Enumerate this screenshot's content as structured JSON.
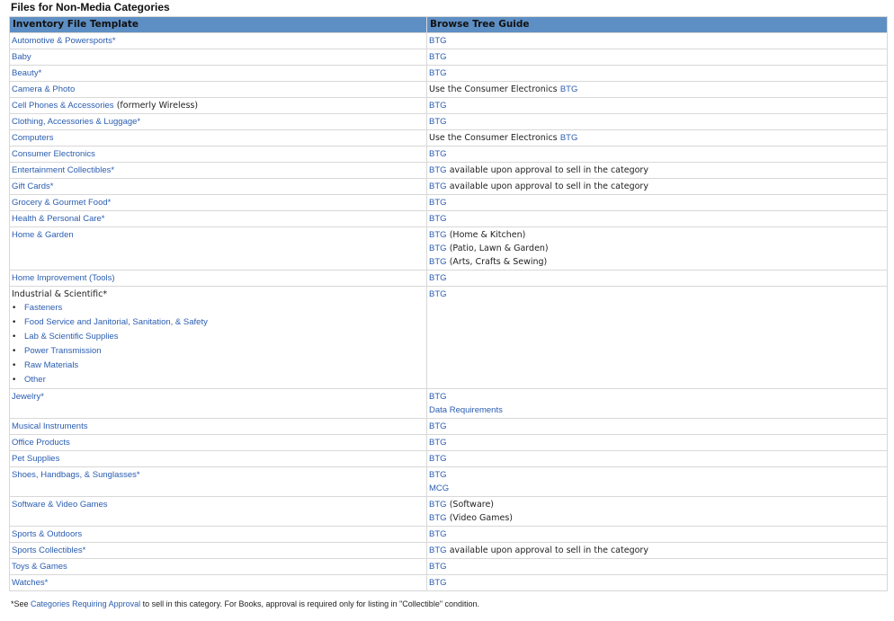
{
  "page_title": "Files for Non-Media Categories",
  "table": {
    "headers": [
      "Inventory File Template",
      "Browse Tree Guide"
    ],
    "rows": [
      {
        "category": "Automotive & Powersports*",
        "guides": [
          {
            "link": "BTG",
            "text": ""
          }
        ]
      },
      {
        "category": "Baby",
        "guides": [
          {
            "link": "BTG",
            "text": ""
          }
        ]
      },
      {
        "category": "Beauty*",
        "guides": [
          {
            "link": "BTG",
            "text": ""
          }
        ]
      },
      {
        "category": "Camera & Photo",
        "guides": [
          {
            "prefix": "Use the Consumer Electronics",
            "link": "BTG",
            "text": ""
          }
        ]
      },
      {
        "category": "Cell Phones & Accessories",
        "category_note": "(formerly Wireless)",
        "guides": [
          {
            "link": "BTG",
            "text": ""
          }
        ]
      },
      {
        "category": "Clothing, Accessories & Luggage*",
        "guides": [
          {
            "link": "BTG",
            "text": ""
          }
        ]
      },
      {
        "category": "Computers",
        "guides": [
          {
            "prefix": "Use the Consumer Electronics",
            "link": "BTG",
            "text": ""
          }
        ]
      },
      {
        "category": "Consumer Electronics",
        "guides": [
          {
            "link": "BTG",
            "text": ""
          }
        ]
      },
      {
        "category": "Entertainment Collectibles*",
        "guides": [
          {
            "link": "BTG",
            "text": "available upon approval to sell in the category"
          }
        ]
      },
      {
        "category": "Gift Cards*",
        "guides": [
          {
            "link": "BTG",
            "text": "available upon approval to sell in the category"
          }
        ]
      },
      {
        "category": "Grocery & Gourmet Food*",
        "guides": [
          {
            "link": "BTG",
            "text": ""
          }
        ]
      },
      {
        "category": "Health & Personal Care*",
        "guides": [
          {
            "link": "BTG",
            "text": ""
          }
        ]
      },
      {
        "category": "Home & Garden",
        "guides": [
          {
            "link": "BTG",
            "text": "(Home & Kitchen)"
          },
          {
            "link": "BTG",
            "text": "(Patio, Lawn & Garden)"
          },
          {
            "link": "BTG",
            "text": "(Arts, Crafts & Sewing)"
          }
        ]
      },
      {
        "category": "Home Improvement (Tools)",
        "guides": [
          {
            "link": "BTG",
            "text": ""
          }
        ]
      },
      {
        "category": "Industrial & Scientific*",
        "plain": true,
        "subitems": [
          "Fasteners",
          "Food Service and Janitorial, Sanitation, & Safety",
          "Lab & Scientific Supplies",
          "Power Transmission",
          "Raw Materials",
          "Other"
        ],
        "guides": [
          {
            "link": "BTG",
            "text": ""
          }
        ]
      },
      {
        "category": "Jewelry*",
        "guides": [
          {
            "link": "BTG",
            "text": ""
          },
          {
            "link": "Data Requirements",
            "text": ""
          }
        ]
      },
      {
        "category": "Musical Instruments",
        "guides": [
          {
            "link": "BTG",
            "text": ""
          }
        ]
      },
      {
        "category": "Office Products",
        "guides": [
          {
            "link": "BTG",
            "text": ""
          }
        ]
      },
      {
        "category": "Pet Supplies",
        "guides": [
          {
            "link": "BTG",
            "text": ""
          }
        ]
      },
      {
        "category": "Shoes, Handbags, & Sunglasses*",
        "guides": [
          {
            "link": "BTG",
            "text": ""
          },
          {
            "link": "MCG",
            "text": ""
          }
        ]
      },
      {
        "category": "Software & Video Games",
        "guides": [
          {
            "link": "BTG",
            "text": "(Software)"
          },
          {
            "link": "BTG",
            "text": "(Video Games)"
          }
        ]
      },
      {
        "category": "Sports & Outdoors",
        "guides": [
          {
            "link": "BTG",
            "text": ""
          }
        ]
      },
      {
        "category": "Sports Collectibles*",
        "guides": [
          {
            "link": "BTG",
            "text": "available upon approval to sell in the category"
          }
        ]
      },
      {
        "category": "Toys & Games",
        "guides": [
          {
            "link": "BTG",
            "text": ""
          }
        ]
      },
      {
        "category": "Watches*",
        "guides": [
          {
            "link": "BTG",
            "text": ""
          }
        ]
      }
    ]
  },
  "footnote": {
    "prefix": "*See",
    "link": "Categories Requiring Approval",
    "suffix": "to sell in this category. For Books, approval is required only for listing in \"Collectible\" condition."
  },
  "colors": {
    "header_bg": "#5e8fc4",
    "link": "#2a5db0",
    "border": "#d8d8d8"
  }
}
